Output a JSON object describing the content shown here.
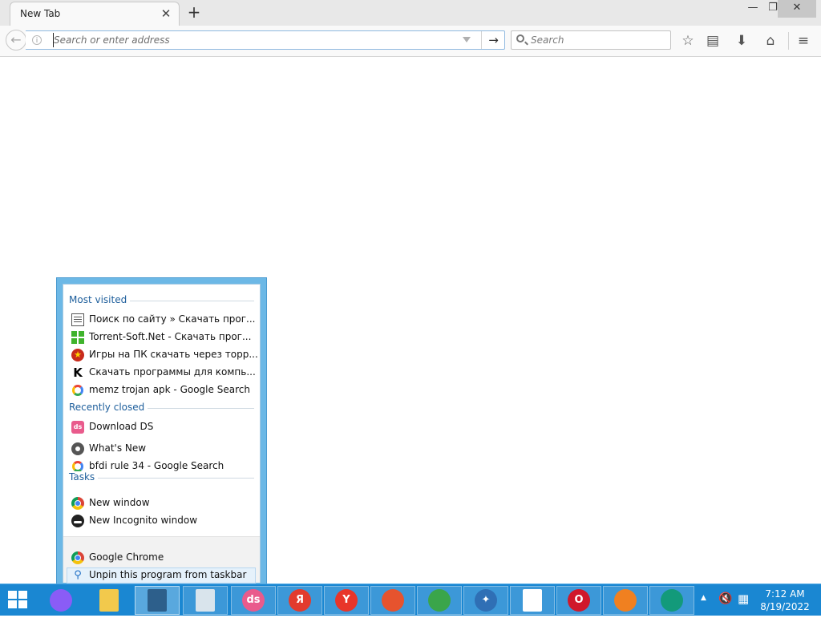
{
  "window": {
    "tab_title": "New Tab",
    "tab_close_glyph": "✕",
    "new_tab_glyph": "+",
    "minimize_glyph": "—",
    "restore_glyph": "❐",
    "close_glyph": "✕"
  },
  "navbar": {
    "back_glyph": "←",
    "info_glyph": "i",
    "url_value": "",
    "url_placeholder": "Search or enter address",
    "go_glyph": "→",
    "search_value": "",
    "search_placeholder": "Search",
    "icons": [
      "star-icon",
      "reader-icon",
      "download-icon",
      "home-icon",
      "menu-icon"
    ],
    "star_glyph": "☆",
    "reader_glyph": "▤",
    "download_glyph": "⬇",
    "home_glyph": "⌂",
    "menu_glyph": "≡"
  },
  "jumplist": {
    "most_visited_header": "Most visited",
    "most_visited": [
      {
        "label": "Поиск по сайту » Скачать прог...",
        "icon": "site-list-icon"
      },
      {
        "label": "Torrent-Soft.Net - Скачать прог...",
        "icon": "windows-logo-icon"
      },
      {
        "label": "Игры на ПК скачать через торр...",
        "icon": "red-star-icon"
      },
      {
        "label": "Скачать программы для компь...",
        "icon": "k-logo-icon"
      },
      {
        "label": "memz trojan apk - Google Search",
        "icon": "google-icon"
      }
    ],
    "recently_closed_header": "Recently closed",
    "recently_closed": [
      {
        "label": "Download DS",
        "icon": "ds-icon"
      },
      {
        "label": "What's New",
        "icon": "chrome-mono-icon"
      },
      {
        "label": "bfdi rule 34 - Google Search",
        "icon": "google-icon"
      }
    ],
    "tasks_header": "Tasks",
    "tasks": [
      {
        "label": "New window",
        "icon": "chrome-icon"
      },
      {
        "label": "New Incognito window",
        "icon": "incognito-icon"
      }
    ],
    "footer": [
      {
        "label": "Google Chrome",
        "icon": "chrome-icon"
      },
      {
        "label": "Unpin this program from taskbar",
        "icon": "unpin-icon"
      }
    ],
    "icon_glyphs": {
      "red_star": "★",
      "k": "K",
      "ds": "ds",
      "unpin": "⚲"
    }
  },
  "taskbar": {
    "apps": [
      {
        "name": "alice-assistant-icon",
        "color": "#8a5cf6",
        "glyph": ""
      },
      {
        "name": "file-explorer-icon",
        "color": "#f2c94c",
        "glyph": ""
      },
      {
        "name": "active-window-icon",
        "color": "#2d5f8b",
        "glyph": ""
      },
      {
        "name": "monitor-app-icon",
        "color": "#d9e4ec",
        "glyph": ""
      },
      {
        "name": "ds-app-icon",
        "color": "#e95b8c",
        "glyph": "ds"
      },
      {
        "name": "yandex-icon",
        "color": "#e23b2e",
        "glyph": "Я"
      },
      {
        "name": "yandex-browser-icon",
        "color": "#e8352a",
        "glyph": "Y"
      },
      {
        "name": "swirl-app-icon",
        "color": "#e6532e",
        "glyph": ""
      },
      {
        "name": "ball-app-icon",
        "color": "#3aa54a",
        "glyph": ""
      },
      {
        "name": "magic-wand-icon",
        "color": "#2f6fb5",
        "glyph": "✦"
      },
      {
        "name": "blank-document-icon",
        "color": "#ffffff",
        "glyph": ""
      },
      {
        "name": "opera-icon",
        "color": "#d0182b",
        "glyph": "O"
      },
      {
        "name": "fire-app-icon",
        "color": "#f08020",
        "glyph": ""
      },
      {
        "name": "green-circle-app-icon",
        "color": "#139a7a",
        "glyph": ""
      }
    ],
    "tray_up_glyph": "▲",
    "tray_speaker_glyph": "🔇",
    "tray_network_glyph": "▦",
    "time": "7:12 AM",
    "date": "8/19/2022"
  }
}
